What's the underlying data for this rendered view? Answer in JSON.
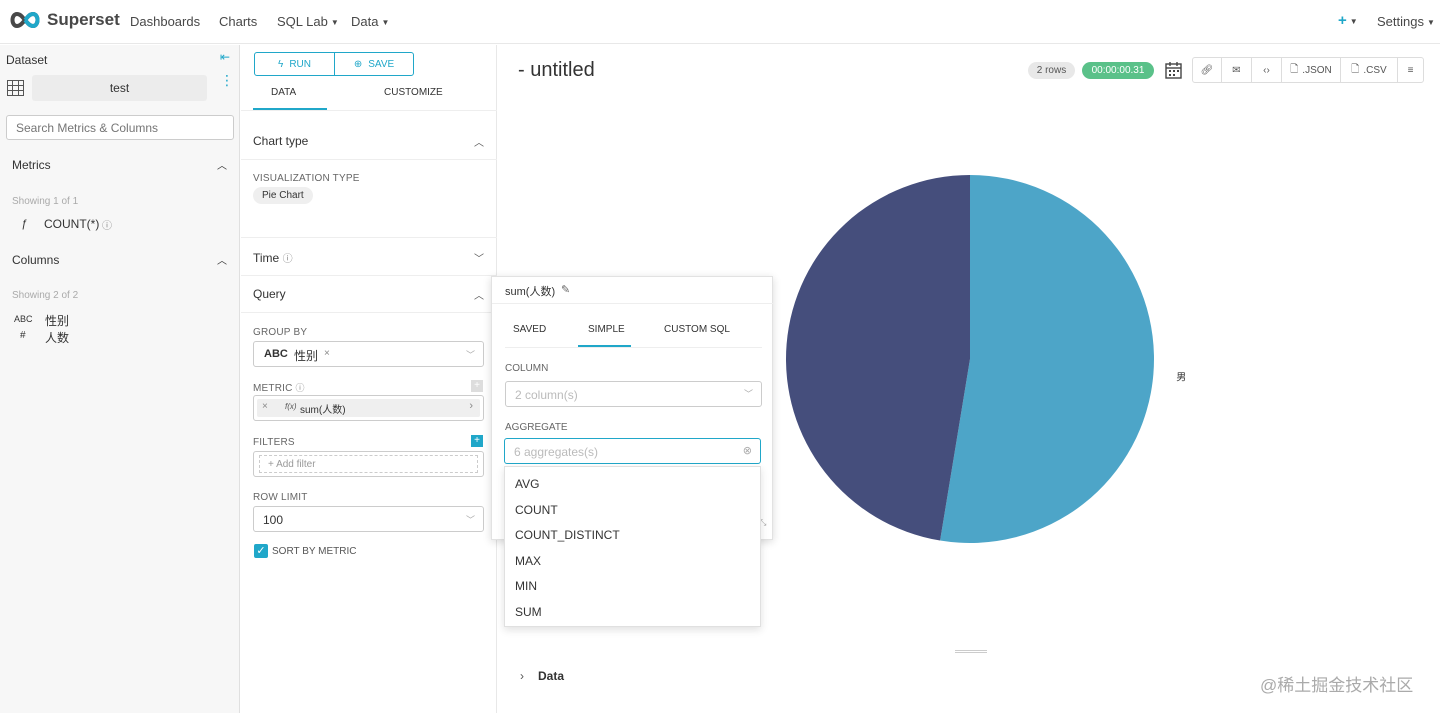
{
  "navbar": {
    "brand": "Superset",
    "items": [
      "Dashboards",
      "Charts",
      "SQL Lab",
      "Data"
    ],
    "settings": "Settings"
  },
  "datasource": {
    "header": "Dataset",
    "name": "test",
    "search_placeholder": "Search Metrics & Columns",
    "metrics_title": "Metrics",
    "metrics_showing": "Showing 1 of 1",
    "metrics": [
      {
        "type": "ƒ",
        "name": "COUNT(*)"
      }
    ],
    "columns_title": "Columns",
    "columns_showing": "Showing 2 of 2",
    "columns": [
      {
        "type": "ABC",
        "name": "性别"
      },
      {
        "type": "#",
        "name": "人数"
      }
    ]
  },
  "controls": {
    "run_label": "RUN",
    "save_label": "SAVE",
    "tab_data": "DATA",
    "tab_customize": "CUSTOMIZE",
    "chart_type_title": "Chart type",
    "viz_type_label": "VISUALIZATION TYPE",
    "viz_type_value": "Pie Chart",
    "time_title": "Time",
    "query_title": "Query",
    "group_by_label": "GROUP BY",
    "group_by_type": "ABC",
    "group_by_value": "性别",
    "metric_label": "METRIC",
    "metric_value": "sum(人数)",
    "metric_fx": "f(x)",
    "filters_label": "FILTERS",
    "add_filter": "Add filter",
    "row_limit_label": "ROW LIMIT",
    "row_limit_value": "100",
    "sort_by_metric": "SORT BY METRIC"
  },
  "chart": {
    "title": "- untitled",
    "rows_badge": "2 rows",
    "timer": "00:00:00.31",
    "json_label": ".JSON",
    "csv_label": ".CSV",
    "data_section": "Data",
    "colors": {
      "accent": "#20a7c9",
      "slice1": "#4da5c8",
      "slice2": "#454e7c",
      "timer_bg": "#5ac189"
    }
  },
  "chart_data": {
    "type": "pie",
    "labels": [
      "男",
      ""
    ],
    "values": [
      52.6,
      47.4
    ],
    "title": ""
  },
  "popover": {
    "title": "sum(人数)",
    "tabs": [
      "SAVED",
      "SIMPLE",
      "CUSTOM SQL"
    ],
    "active_tab": "SIMPLE",
    "column_label": "COLUMN",
    "column_placeholder": "2 column(s)",
    "aggregate_label": "AGGREGATE",
    "aggregate_placeholder": "6 aggregates(s)",
    "aggregate_options": [
      "AVG",
      "COUNT",
      "COUNT_DISTINCT",
      "MAX",
      "MIN",
      "SUM"
    ]
  },
  "watermark": "@稀土掘金技术社区"
}
